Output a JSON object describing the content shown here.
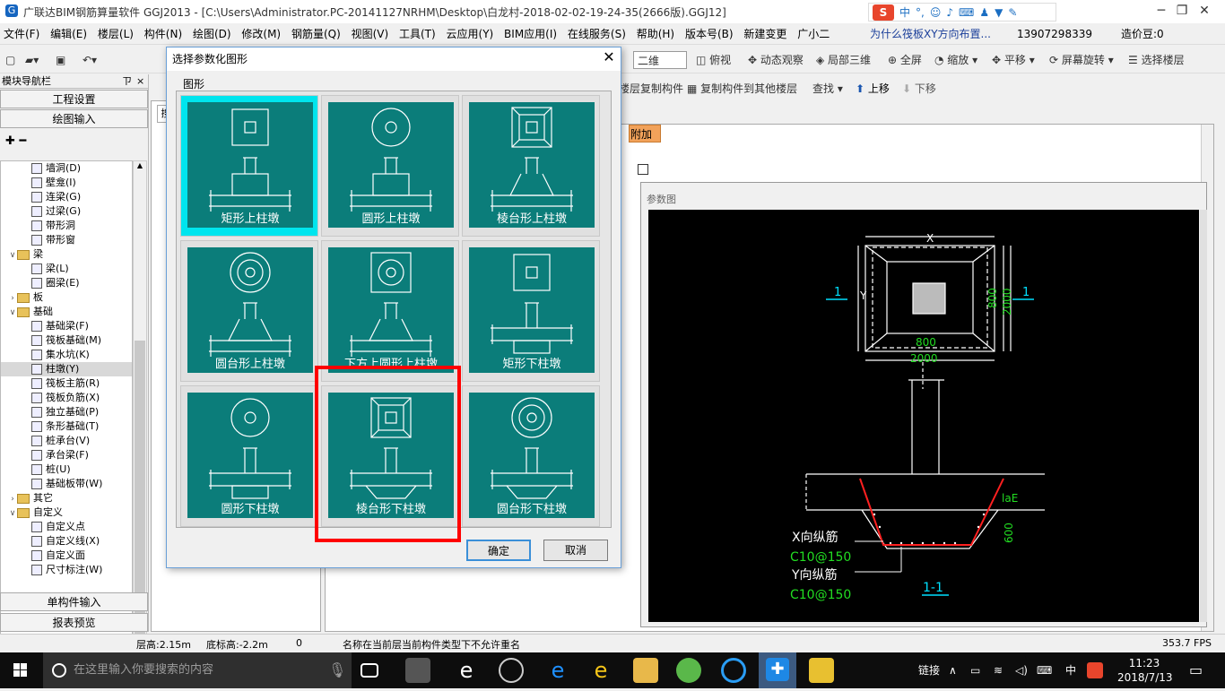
{
  "window": {
    "title": "广联达BIM钢筋算量软件 GGJ2013 - [C:\\Users\\Administrator.PC-20141127NRHM\\Desktop\\白龙村-2018-02-02-19-24-35(2666版).GGJ12]",
    "app_icon": "G",
    "minimize": "─",
    "restore": "❐",
    "close": "✕"
  },
  "ime_bar": {
    "logo": "S",
    "mode": "中",
    "icons": [
      "°,",
      "☺",
      "mic-icon",
      "keyboard-icon",
      "user-icon",
      "shirt-icon",
      "wrench-icon"
    ]
  },
  "menu": [
    "文件(F)",
    "编辑(E)",
    "楼层(L)",
    "构件(N)",
    "绘图(D)",
    "修改(M)",
    "钢筋量(Q)",
    "视图(V)",
    "工具(T)",
    "云应用(Y)",
    "BIM应用(I)",
    "在线服务(S)",
    "帮助(H)",
    "版本号(B)",
    "新建变更",
    "广小二"
  ],
  "menu_right": {
    "question": "为什么筏板XY方向布置...",
    "phone": "13907298339",
    "points": "造价豆:0"
  },
  "toolbar1": {
    "view_mode": "二维",
    "top_view": "俯视",
    "dynamic": "动态观察",
    "local3d": "局部三维",
    "fullscreen": "全屏",
    "zoom": "缩放",
    "pan": "平移",
    "rotate": "屏幕旋转",
    "select_floor": "选择楼层"
  },
  "toolbar2": {
    "copy_floor": "楼层复制构件",
    "copy_to_other": "复制构件到其他楼层",
    "find": "查找",
    "up": "上移",
    "down": "下移"
  },
  "nav": {
    "header": "模块导航栏",
    "pin": "ㄗ",
    "close": "×",
    "project_settings": "工程设置",
    "drawing_input": "绘图输入",
    "single_input": "单构件输入",
    "report_preview": "报表预览",
    "tree": [
      {
        "label": "墙洞(D)",
        "level": 2
      },
      {
        "label": "壁龛(I)",
        "level": 2
      },
      {
        "label": "连梁(G)",
        "level": 2
      },
      {
        "label": "过梁(G)",
        "level": 2
      },
      {
        "label": "带形洞",
        "level": 2
      },
      {
        "label": "带形窗",
        "level": 2
      },
      {
        "label": "梁",
        "level": 1,
        "folder": true,
        "open": true
      },
      {
        "label": "梁(L)",
        "level": 2
      },
      {
        "label": "圈梁(E)",
        "level": 2
      },
      {
        "label": "板",
        "level": 1,
        "folder": true,
        "open": false
      },
      {
        "label": "基础",
        "level": 1,
        "folder": true,
        "open": true
      },
      {
        "label": "基础梁(F)",
        "level": 2
      },
      {
        "label": "筏板基础(M)",
        "level": 2
      },
      {
        "label": "集水坑(K)",
        "level": 2
      },
      {
        "label": "柱墩(Y)",
        "level": 2,
        "selected": true
      },
      {
        "label": "筏板主筋(R)",
        "level": 2
      },
      {
        "label": "筏板负筋(X)",
        "level": 2
      },
      {
        "label": "独立基础(P)",
        "level": 2
      },
      {
        "label": "条形基础(T)",
        "level": 2
      },
      {
        "label": "桩承台(V)",
        "level": 2
      },
      {
        "label": "承台梁(F)",
        "level": 2
      },
      {
        "label": "桩(U)",
        "level": 2
      },
      {
        "label": "基础板带(W)",
        "level": 2
      },
      {
        "label": "其它",
        "level": 1,
        "folder": true,
        "open": false
      },
      {
        "label": "自定义",
        "level": 1,
        "folder": true,
        "open": true
      },
      {
        "label": "自定义点",
        "level": 2
      },
      {
        "label": "自定义线(X)",
        "level": 2
      },
      {
        "label": "自定义面",
        "level": 2
      },
      {
        "label": "尺寸标注(W)",
        "level": 2
      }
    ]
  },
  "mid_panel": {
    "search_prefix": "搜"
  },
  "grid_panel": {
    "col_extra": "附加"
  },
  "param_window": {
    "caption": "参数图",
    "dims": {
      "x": "X",
      "y": "Y",
      "d800a": "800",
      "d2000a": "2000",
      "d800b": "800",
      "d2000b": "2000",
      "sec1": "1",
      "sec1b": "1",
      "lae": "laE",
      "d600": "600",
      "section": "1-1"
    },
    "labels": {
      "x_bar": "X向纵筋",
      "x_spec": "C10@150",
      "y_bar": "Y向纵筋",
      "y_spec": "C10@150"
    }
  },
  "dialog": {
    "title": "选择参数化图形",
    "close": "✕",
    "group_label": "图形",
    "shapes": [
      {
        "label": "矩形上柱墩",
        "selected": true,
        "top": "square",
        "body": "rect-up"
      },
      {
        "label": "圆形上柱墩",
        "selected": false,
        "top": "circle",
        "body": "rect-up"
      },
      {
        "label": "棱台形上柱墩",
        "selected": false,
        "top": "frustum-square",
        "body": "trap-up"
      },
      {
        "label": "圆台形上柱墩",
        "selected": false,
        "top": "double-circle",
        "body": "trap-up"
      },
      {
        "label": "下方上圆形上柱墩",
        "selected": false,
        "top": "square-circle",
        "body": "trap-up"
      },
      {
        "label": "矩形下柱墩",
        "selected": false,
        "top": "square",
        "body": "rect-down"
      },
      {
        "label": "圆形下柱墩",
        "selected": false,
        "top": "circle",
        "body": "rect-down"
      },
      {
        "label": "棱台形下柱墩",
        "selected": false,
        "top": "frustum-square",
        "body": "trap-down"
      },
      {
        "label": "圆台形下柱墩",
        "selected": false,
        "top": "double-circle",
        "body": "trap-down"
      }
    ],
    "ok": "确定",
    "cancel": "取消"
  },
  "status": {
    "floor_height": "层高:2.15m",
    "base_height": "底标高:-2.2m",
    "num": "0",
    "message": "名称在当前层当前构件类型下不允许重名",
    "fps": "353.7 FPS"
  },
  "taskbar": {
    "search_placeholder": "在这里输入你要搜索的内容",
    "link": "链接",
    "lang": "中",
    "time": "11:23",
    "date": "2018/7/13"
  },
  "colors": {
    "tile": "#0b7d7a",
    "selected_frame": "#00e5ee",
    "highlight": "#ff0000",
    "cad_green": "#22dd22",
    "cad_cyan": "#00e0ff"
  }
}
